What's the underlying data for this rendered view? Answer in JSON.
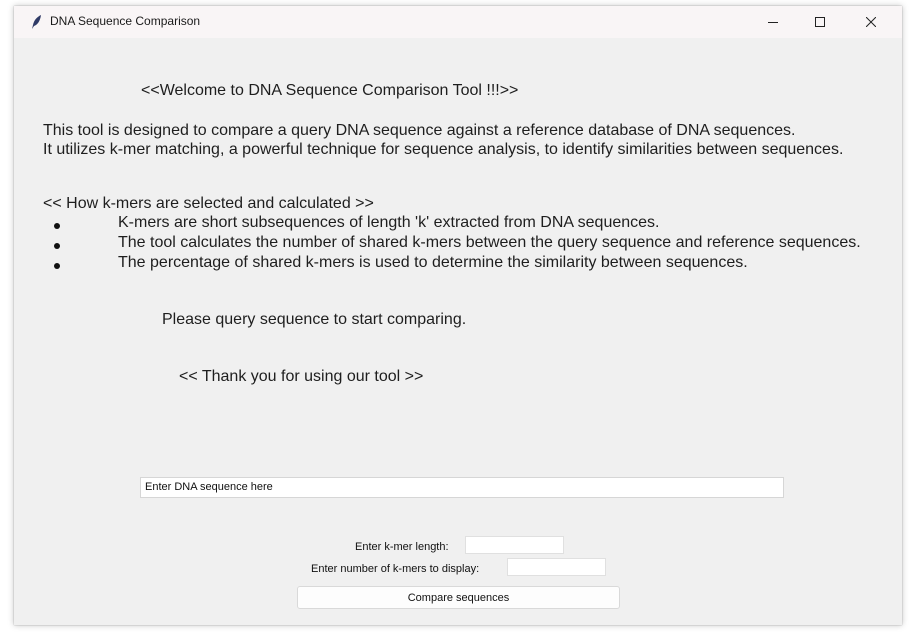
{
  "window": {
    "title": "DNA Sequence Comparison"
  },
  "content": {
    "welcome": "<<Welcome to DNA Sequence Comparison Tool !!!>>",
    "description_line1": "This tool is designed to compare a query DNA sequence against a reference database of DNA sequences.",
    "description_line2": "It utilizes k-mer matching, a powerful technique for sequence analysis, to identify similarities between sequences.",
    "howto_heading": "<< How k-mers are selected and calculated >>",
    "bullets": [
      "K-mers are short subsequences of length 'k' extracted from DNA sequences.",
      "The tool calculates the number of shared k-mers between the query sequence and reference sequences.",
      "The percentage of shared k-mers is used to determine the similarity between sequences."
    ],
    "please_text": "Please  query sequence to start comparing.",
    "thanks_text": "<< Thank you for using our tool >>"
  },
  "form": {
    "sequence_value": "Enter DNA sequence here",
    "kmer_length_label": "Enter k-mer length:",
    "kmer_length_value": "",
    "kmer_count_label": "Enter number of k-mers to display:",
    "kmer_count_value": "",
    "compare_button": "Compare sequences"
  },
  "icons": {
    "app": "feather-icon",
    "minimize": "minimize-icon",
    "maximize": "maximize-icon",
    "close": "close-icon"
  }
}
